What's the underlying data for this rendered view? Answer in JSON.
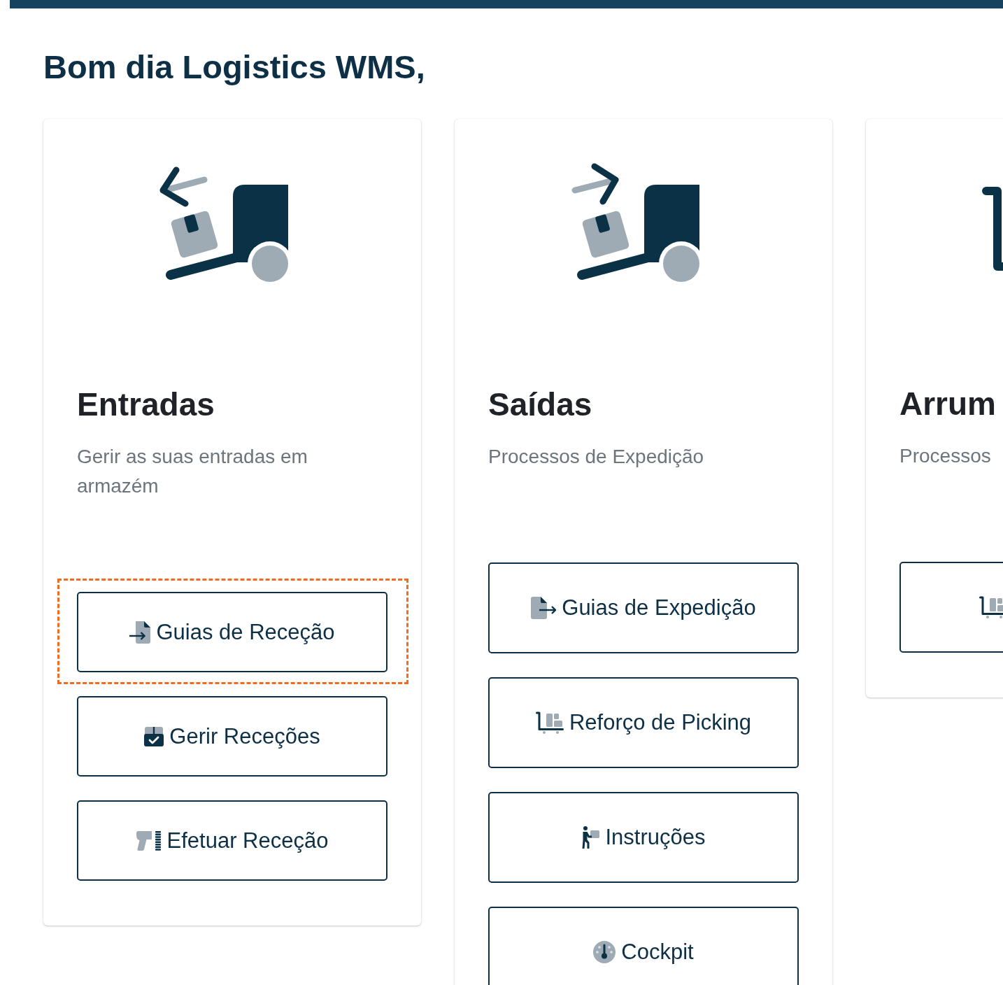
{
  "greeting": "Bom dia Logistics WMS,",
  "cards": [
    {
      "kind": "inbound",
      "title": "Entradas",
      "description": "Gerir as suas entradas em armazém",
      "actions": [
        {
          "kind": "docin",
          "label": "Guias de Receção",
          "highlighted": true
        },
        {
          "kind": "boxcheck",
          "label": "Gerir Receções",
          "highlighted": false
        },
        {
          "kind": "scanner",
          "label": "Efetuar Receção",
          "highlighted": false
        }
      ]
    },
    {
      "kind": "outbound",
      "title": "Saídas",
      "description": "Processos de Expedição",
      "actions": [
        {
          "kind": "docout",
          "label": "Guias de Expedição",
          "highlighted": false
        },
        {
          "kind": "trolley",
          "label": "Reforço de Picking",
          "highlighted": false
        },
        {
          "kind": "worker",
          "label": "Instruções",
          "highlighted": false
        },
        {
          "kind": "gauge",
          "label": "Cockpit",
          "highlighted": false
        }
      ]
    },
    {
      "kind": "putaway",
      "title": "Arrum",
      "description": "Processos",
      "actions": [
        {
          "kind": "trolley",
          "highlighted": false
        }
      ]
    }
  ]
}
